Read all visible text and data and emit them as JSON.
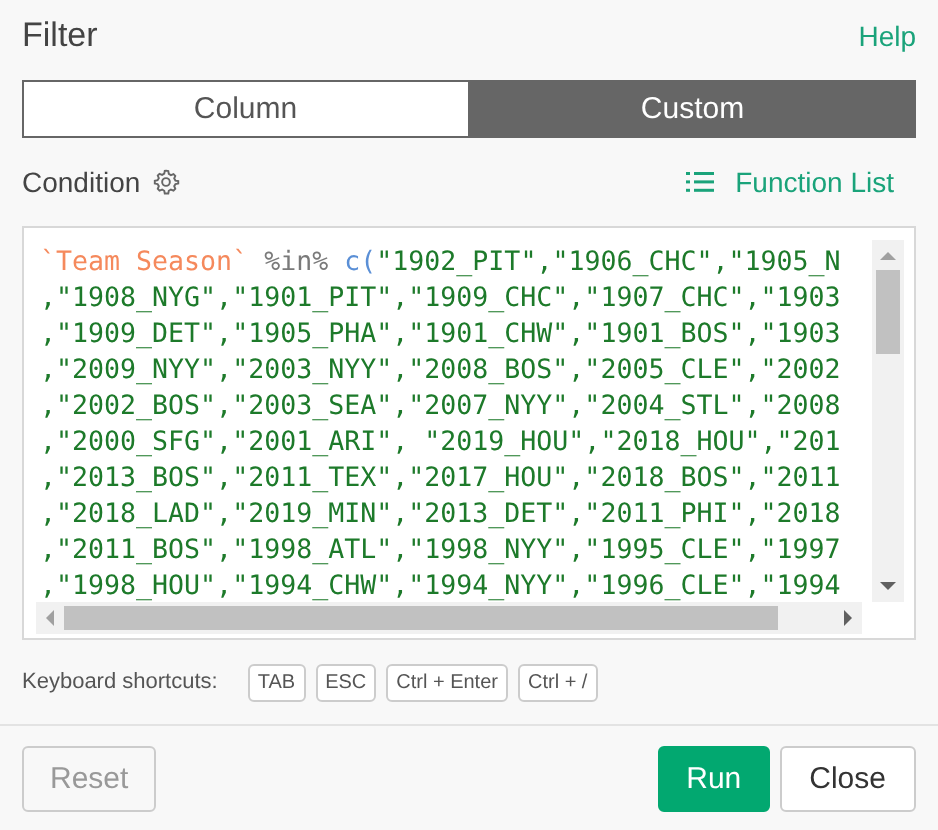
{
  "title": "Filter",
  "help": "Help",
  "tabs": [
    {
      "label": "Column",
      "selected": false
    },
    {
      "label": "Custom",
      "selected": true
    }
  ],
  "condition_label": "Condition",
  "function_list": "Function List",
  "code_lines": [
    [
      {
        "kind": "column",
        "text": "`Team Season`"
      },
      {
        "kind": "operator",
        "text": " %in% "
      },
      {
        "kind": "function",
        "text": "c("
      },
      {
        "kind": "string",
        "text": "\"1902_PIT\",\"1906_CHC\",\"1905_N"
      }
    ],
    [
      {
        "kind": "string",
        "text": ",\"1908_NYG\",\"1901_PIT\",\"1909_CHC\",\"1907_CHC\",\"1903"
      }
    ],
    [
      {
        "kind": "string",
        "text": ",\"1909_DET\",\"1905_PHA\",\"1901_CHW\",\"1901_BOS\",\"1903"
      }
    ],
    [
      {
        "kind": "string",
        "text": ",\"2009_NYY\",\"2003_NYY\",\"2008_BOS\",\"2005_CLE\",\"2002"
      }
    ],
    [
      {
        "kind": "string",
        "text": ",\"2002_BOS\",\"2003_SEA\",\"2007_NYY\",\"2004_STL\",\"2008"
      }
    ],
    [
      {
        "kind": "string",
        "text": ",\"2000_SFG\",\"2001_ARI\", \"2019_HOU\",\"2018_HOU\",\"201"
      }
    ],
    [
      {
        "kind": "string",
        "text": ",\"2013_BOS\",\"2011_TEX\",\"2017_HOU\",\"2018_BOS\",\"2011"
      }
    ],
    [
      {
        "kind": "string",
        "text": ",\"2018_LAD\",\"2019_MIN\",\"2013_DET\",\"2011_PHI\",\"2018"
      }
    ],
    [
      {
        "kind": "string",
        "text": ",\"2011_BOS\",\"1998_ATL\",\"1998_NYY\",\"1995_CLE\",\"1997"
      }
    ],
    [
      {
        "kind": "string",
        "text": ",\"1998_HOU\",\"1994_CHW\",\"1994_NYY\",\"1996_CLE\",\"1994"
      }
    ]
  ],
  "shortcuts_label": "Keyboard shortcuts:",
  "shortcuts": [
    "TAB",
    "ESC",
    "Ctrl + Enter",
    "Ctrl + /"
  ],
  "buttons": [
    {
      "label": "Reset",
      "kind": "secondary",
      "disabled": true
    },
    {
      "label": "Run",
      "kind": "primary",
      "disabled": false
    },
    {
      "label": "Close",
      "kind": "secondary",
      "disabled": false
    }
  ]
}
